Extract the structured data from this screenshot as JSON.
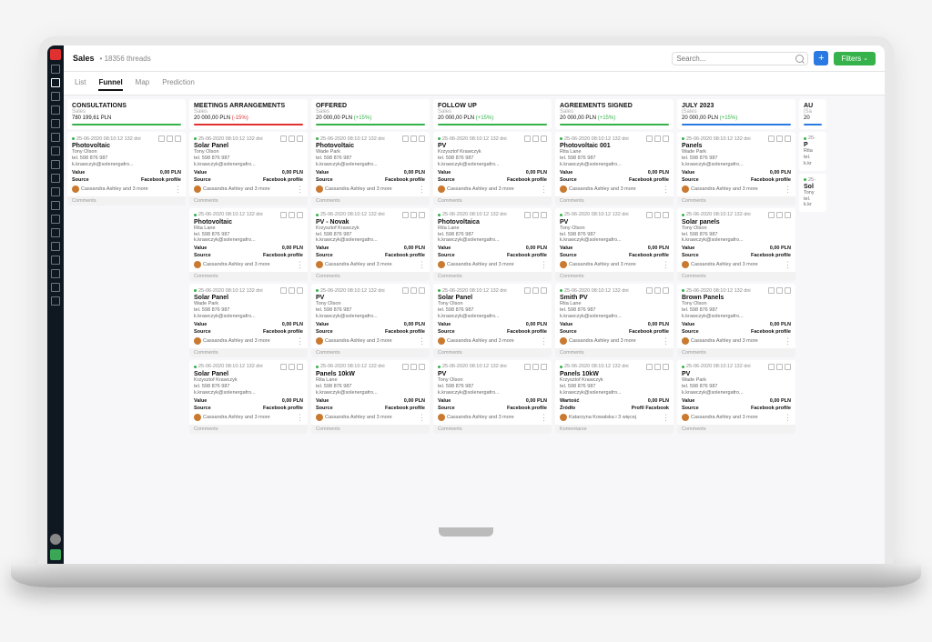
{
  "header": {
    "title": "Sales",
    "threads": "18356 threads",
    "search_ph": "Search...",
    "filters": "Filters"
  },
  "tabs": [
    "List",
    "Funnel",
    "Map",
    "Prediction"
  ],
  "tabs_active": 1,
  "card_meta": {
    "date": "25-06-2020 08:10:12 132 dni",
    "value_label": "Value",
    "value": "0,00 PLN",
    "source_label": "Source",
    "source": "Facebook profile",
    "assignee": "Cassandra Ashley and 3 more",
    "comments": "Comments"
  },
  "alt_meta": {
    "source_label": "Źródło",
    "value_label": "Wartość",
    "source": "Profil Facebook",
    "assignee": "Katarzyna Kowalska i 3 więcej",
    "comments": "Komentarze"
  },
  "persons": {
    "tony": {
      "name": "Tony Olson",
      "tel": "tel. 598 876 987",
      "email": "k.krawczyk@solenergafro..."
    },
    "wade": {
      "name": "Wade Park",
      "tel": "tel. 598 876 987",
      "email": "k.krawczyk@solenergafro..."
    },
    "rita": {
      "name": "Rita Lane",
      "tel": "tel. 598 876 987",
      "email": "k.krawczyk@solenergafro..."
    },
    "kk": {
      "name": "Krzysztof Krawczyk",
      "tel": "tel. 598 876 987",
      "email": "k.krawczyk@solenergafro..."
    }
  },
  "columns": [
    {
      "title": "CONSULTATIONS",
      "sub": "Sales",
      "val": "780 199,61 PLN",
      "pct": "",
      "bar": "green",
      "cards": [
        {
          "t": "Photovoltaic",
          "p": "tony"
        }
      ]
    },
    {
      "title": "MEETINGS ARRANGEMENTS",
      "sub": "Sales",
      "val": "20 000,00 PLN",
      "pct": "(-15%)",
      "neg": true,
      "bar": "red",
      "cards": [
        {
          "t": "Solar Panel",
          "p": "tony"
        },
        {
          "t": "Photovoltaic",
          "p": "rita"
        },
        {
          "t": "Solar Panel",
          "p": "wade"
        },
        {
          "t": "Solar Panel",
          "p": "kk"
        }
      ]
    },
    {
      "title": "OFFERED",
      "sub": "Sales",
      "val": "20 000,00 PLN",
      "pct": "(+15%)",
      "bar": "green",
      "cards": [
        {
          "t": "Photovoltaic",
          "p": "wade"
        },
        {
          "t": "PV - Novak",
          "p": "kk"
        },
        {
          "t": "PV",
          "p": "tony"
        },
        {
          "t": "Panels 10kW",
          "p": "rita"
        }
      ]
    },
    {
      "title": "FOLLOW UP",
      "sub": "Sales",
      "val": "20 000,00 PLN",
      "pct": "(+15%)",
      "bar": "green",
      "cards": [
        {
          "t": "PV",
          "p": "kk"
        },
        {
          "t": "Photovoltaica",
          "p": "rita"
        },
        {
          "t": "Solar Panel",
          "p": "tony"
        },
        {
          "t": "PV",
          "p": "tony"
        }
      ]
    },
    {
      "title": "AGREEMENTS SIGNED",
      "sub": "Sales",
      "val": "20 000,00 PLN",
      "pct": "(+15%)",
      "bar": "green",
      "cards": [
        {
          "t": "Photovoltaic 001",
          "p": "rita"
        },
        {
          "t": "PV",
          "p": "tony"
        },
        {
          "t": "Smith PV",
          "p": "rita"
        },
        {
          "t": "Panels 10kW",
          "p": "kk",
          "alt": true
        }
      ]
    },
    {
      "title": "JULY 2023",
      "sub": "|Sales",
      "val": "20 000,00 PLN",
      "pct": "(+15%)",
      "bar": "blue",
      "cards": [
        {
          "t": "Panels",
          "p": "wade"
        },
        {
          "t": "Solar panels",
          "p": "tony"
        },
        {
          "t": "Brown Panels",
          "p": "tony"
        },
        {
          "t": "PV",
          "p": "wade"
        }
      ]
    },
    {
      "title": "AU",
      "sub": "|Sa",
      "val": "20",
      "pct": "",
      "bar": "blue",
      "cut": true,
      "cards": [
        {
          "t": "P",
          "p": "rita",
          "cut": true
        },
        {
          "t": "Sol",
          "p": "tony",
          "cut": true
        }
      ]
    }
  ]
}
